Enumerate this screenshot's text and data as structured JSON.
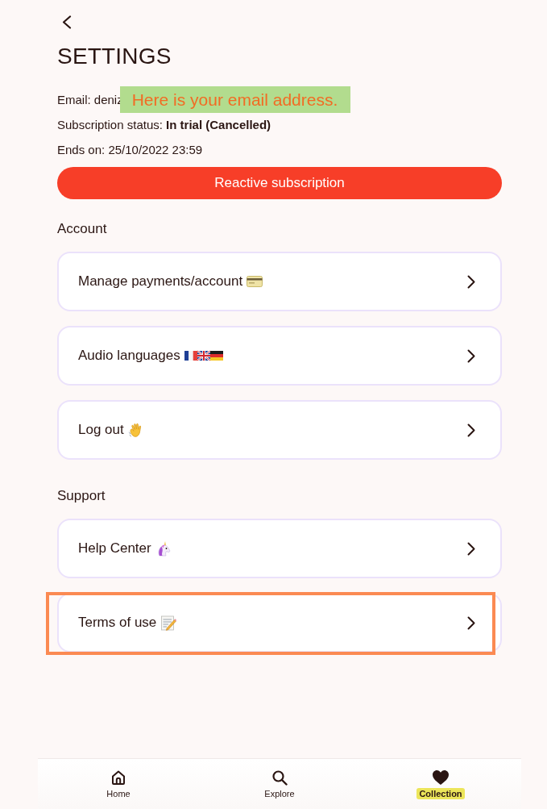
{
  "title": "SETTINGS",
  "info_lines": [
    "Email: deniz",
    "Subscription status: **In trial (Cancelled)**",
    "Ends on: 25/10/2022 23:59"
  ],
  "callout": "Here is your email address.",
  "action_button": "Reactive subscription",
  "sections": [
    {
      "title": "Account",
      "items": [
        {
          "label": "Manage payments/account",
          "highlighted": false
        },
        {
          "label": "Audio languages",
          "highlighted": false
        },
        {
          "label": "Log out",
          "highlighted": false
        }
      ]
    },
    {
      "title": "Support",
      "items": [
        {
          "label": "Help Center",
          "highlighted": false
        },
        {
          "label": "Terms of use",
          "highlighted": true
        }
      ]
    }
  ],
  "nav": [
    {
      "label": "Home",
      "selected": false
    },
    {
      "label": "Explore",
      "selected": false
    },
    {
      "label": "Collection",
      "selected": true
    }
  ]
}
